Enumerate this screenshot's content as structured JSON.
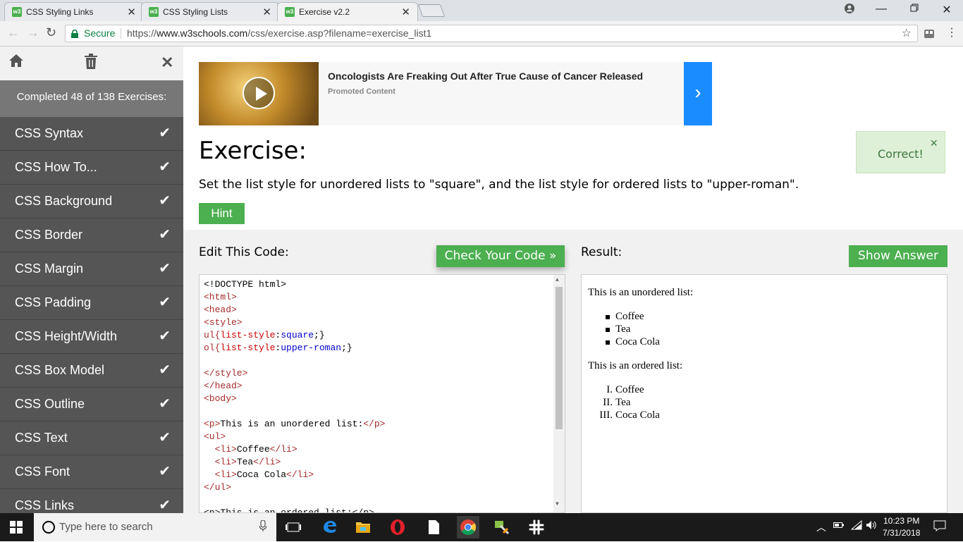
{
  "browser": {
    "tabs": [
      {
        "title": "CSS Styling Links",
        "close": "✕",
        "active": false
      },
      {
        "title": "CSS Styling Lists",
        "close": "✕",
        "active": false
      },
      {
        "title": "Exercise v2.2",
        "close": "✕",
        "active": true
      }
    ],
    "favicon_text": "w3",
    "address": {
      "secure_label": "Secure",
      "url_scheme": "https://",
      "url_host": "www.w3schools.com",
      "url_path": "/css/exercise.asp?filename=exercise_list1"
    }
  },
  "sidebar": {
    "completed_text": "Completed 48 of 138 Exercises:",
    "items": [
      {
        "label": "CSS Syntax"
      },
      {
        "label": "CSS How To..."
      },
      {
        "label": "CSS Background"
      },
      {
        "label": "CSS Border"
      },
      {
        "label": "CSS Margin"
      },
      {
        "label": "CSS Padding"
      },
      {
        "label": "CSS Height/Width"
      },
      {
        "label": "CSS Box Model"
      },
      {
        "label": "CSS Outline"
      },
      {
        "label": "CSS Text"
      },
      {
        "label": "CSS Font"
      },
      {
        "label": "CSS Links"
      }
    ],
    "check_glyph": "✔"
  },
  "ad": {
    "title": "Oncologists Are Freaking Out After True Cause of Cancer Released",
    "sub": "Promoted Content",
    "arrow": "›"
  },
  "exercise": {
    "title": "Exercise:",
    "description": "Set the list style for unordered lists to \"square\", and the list style for ordered lists to \"upper-roman\".",
    "hint_label": "Hint",
    "correct_text": "Correct!",
    "correct_close": "×"
  },
  "workspace": {
    "edit_label": "Edit This Code:",
    "check_label": "Check Your Code »",
    "result_label": "Result:",
    "answer_label": "Show Answer"
  },
  "code": {
    "line1": "<!DOCTYPE html>",
    "line2_tag": "<html>",
    "line3_tag": "<head>",
    "line4_tag": "<style>",
    "line5_sel": "ul{",
    "line5_prop": "list-style",
    "line5_colon": ":",
    "line5_val": "square",
    "line5_end": ";}",
    "line6_sel": "ol{",
    "line6_prop": "list-style",
    "line6_colon": ":",
    "line6_val": "upper-roman",
    "line6_end": ";}",
    "line8_tag": "</style>",
    "line9_tag": "</head>",
    "line10_tag": "<body>",
    "line12_open": "<p>",
    "line12_text": "This is an unordered list:",
    "line12_close": "</p>",
    "line13_tag": "<ul>",
    "li_open": "<li>",
    "li_close": "</li>",
    "li1_text": "Coffee",
    "li2_text": "Tea",
    "li3_text": "Coca Cola",
    "line17_tag": "</ul>",
    "line19_partial": "<p>This is an ordered list:</p>"
  },
  "result": {
    "ul_intro": "This is an unordered list:",
    "ul_items": [
      "Coffee",
      "Tea",
      "Coca Cola"
    ],
    "ol_intro": "This is an ordered list:",
    "ol_numerals": [
      "I.",
      "II.",
      "III."
    ],
    "ol_items": [
      "Coffee",
      "Tea",
      "Coca Cola"
    ]
  },
  "taskbar": {
    "search_placeholder": "Type here to search",
    "time": "10:23 PM",
    "date": "7/31/2018"
  },
  "colors": {
    "w3_green": "#4caf50",
    "sidebar_bg": "#555555",
    "ad_blue": "#1a8cff"
  }
}
